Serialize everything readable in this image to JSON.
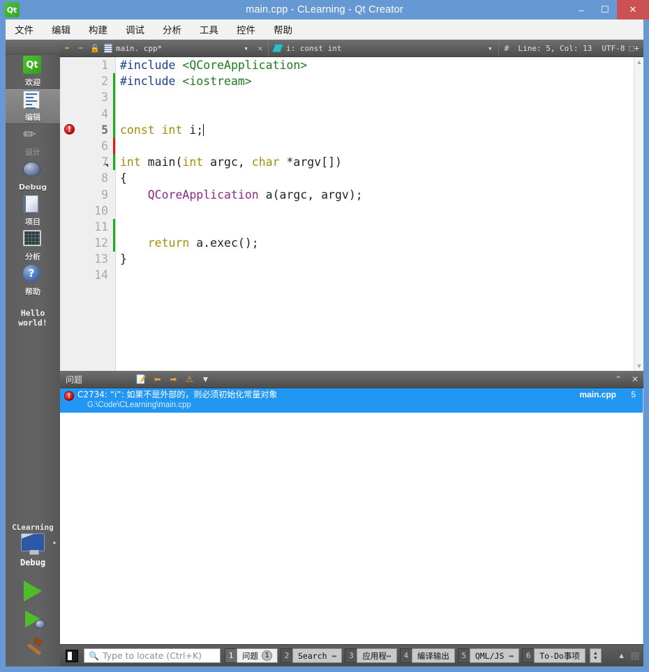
{
  "window": {
    "title": "main.cpp - CLearning - Qt Creator",
    "app_icon": "qt-logo-icon",
    "minimize": "–",
    "maximize": "☐",
    "close": "✕",
    "close_color": "#cc5154",
    "titlebar_color": "#6699d4"
  },
  "menubar": {
    "items": [
      {
        "label": "文件"
      },
      {
        "label": "编辑"
      },
      {
        "label": "构建"
      },
      {
        "label": "调试"
      },
      {
        "label": "分析"
      },
      {
        "label": "工具"
      },
      {
        "label": "控件"
      },
      {
        "label": "帮助"
      }
    ]
  },
  "modebar": {
    "items": [
      {
        "label": "欢迎",
        "icon": "qt-logo-icon",
        "state": "normal"
      },
      {
        "label": "编辑",
        "icon": "edit-document-icon",
        "state": "selected"
      },
      {
        "label": "设计",
        "icon": "design-pencil-ruler-icon",
        "state": "disabled"
      },
      {
        "label": "Debug",
        "icon": "bug-icon",
        "state": "normal"
      },
      {
        "label": "项目",
        "icon": "projects-folder-icon",
        "state": "normal"
      },
      {
        "label": "分析",
        "icon": "analyze-graph-icon",
        "state": "normal"
      },
      {
        "label": "帮助",
        "icon": "help-question-icon",
        "state": "normal"
      }
    ],
    "console_text": "Hello world!",
    "kit": {
      "project_name": "CLearning",
      "build_config": "Debug",
      "kit_icon": "desktop-kit-icon",
      "expand_arrow": "▸",
      "run_button": "run-play-icon",
      "debug_button": "run-debug-icon",
      "build_button": "build-hammer-icon"
    }
  },
  "editor": {
    "toolbar": {
      "back_icon": "⬅",
      "forward_icon": "➡",
      "lock_icon": "🔓",
      "file_name": "main. cpp*",
      "dropdown_arrow": "▾",
      "close_icon": "✕",
      "symbol_name": "i: const int",
      "symbol_dropdown": "▾",
      "hash_icon": "#",
      "cursor_position": "Line: 5, Col: 13",
      "encoding": "UTF-8",
      "split_icon": "⬚+"
    },
    "line_count": 14,
    "lines": [
      {
        "num": "1",
        "marker": "none",
        "change": "none"
      },
      {
        "num": "2",
        "marker": "none",
        "change": "green"
      },
      {
        "num": "3",
        "marker": "none",
        "change": "green"
      },
      {
        "num": "4",
        "marker": "none",
        "change": "green"
      },
      {
        "num": "5",
        "marker": "error",
        "change": "red"
      },
      {
        "num": "6",
        "marker": "none",
        "change": "green"
      },
      {
        "num": "7",
        "marker": "fold",
        "change": "none"
      },
      {
        "num": "8",
        "marker": "none",
        "change": "none"
      },
      {
        "num": "9",
        "marker": "none",
        "change": "none"
      },
      {
        "num": "10",
        "marker": "none",
        "change": "green"
      },
      {
        "num": "11",
        "marker": "none",
        "change": "green"
      },
      {
        "num": "12",
        "marker": "none",
        "change": "none"
      },
      {
        "num": "13",
        "marker": "none",
        "change": "none"
      },
      {
        "num": "14",
        "marker": "none",
        "change": "none"
      }
    ],
    "code": {
      "l1_pre": "#include ",
      "l1_inc": "<QCoreApplication>",
      "l2_pre": "#include ",
      "l2_inc": "<iostream>",
      "l5_kw1": "const",
      "l5_kw2": " int",
      "l5_rest": " i;",
      "l7_kw1": "int",
      "l7_main": " main(",
      "l7_kw2": "int",
      "l7_argc": " argc, ",
      "l7_kw3": "char",
      "l7_rest": " *argv[])",
      "l8": "{",
      "l9_type": "QCoreApplication",
      "l9_rest": " a(argc, argv);",
      "l12_kw": "return",
      "l12_rest": " a.exec();",
      "l13": "}"
    },
    "colors": {
      "preprocessor": "#1a3f8f",
      "include_string": "#1f7a1f",
      "keyword": "#a88c00",
      "type": "#8a2a8a",
      "plain": "#222222",
      "gutter_bg": "#efefef",
      "change_marker": "#1faa1f",
      "error_marker": "#e21b1b"
    },
    "scrollbar": {
      "up_arrow": "▲",
      "down_arrow": "▼"
    }
  },
  "issues": {
    "title": "问题",
    "toolbar_icons": [
      "filter-issues-icon",
      "prev-issue-icon",
      "next-issue-icon",
      "warning-toggle-icon",
      "filter-funnel-icon"
    ],
    "collapse_icon": "⌃",
    "close_icon": "✕",
    "rows": [
      {
        "severity": "error",
        "code": "C2734:",
        "message": "“i”: 如果不是外部的，则必须初始化常量对象",
        "path": "G:\\Code\\CLearning\\main.cpp",
        "file": "main.cpp",
        "line": "5"
      }
    ],
    "selection_color": "#2196f3"
  },
  "bottombar": {
    "sidebar_toggle": "sidebar-toggle-icon",
    "locate_placeholder": "Type to locate (Ctrl+K)",
    "locate_value": "",
    "locate_icon": "search-magnifier-icon",
    "tabs": [
      {
        "num": "1",
        "label": "问题",
        "badge": "1",
        "active": true
      },
      {
        "num": "2",
        "label": "Search ⋯",
        "badge": "",
        "active": false
      },
      {
        "num": "3",
        "label": "应用程⋯",
        "badge": "",
        "active": false
      },
      {
        "num": "4",
        "label": "编译输出",
        "badge": "",
        "active": false
      },
      {
        "num": "5",
        "label": "QML/JS ⋯",
        "badge": "",
        "active": false
      },
      {
        "num": "6",
        "label": "To-Do事项",
        "badge": "",
        "active": false
      }
    ],
    "spinner_up": "▲",
    "spinner_down": "▼",
    "maximize_output": "▲"
  }
}
